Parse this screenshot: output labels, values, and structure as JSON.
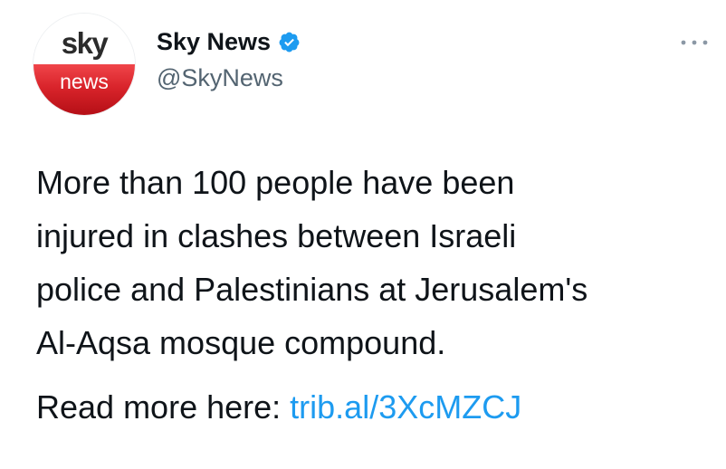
{
  "author": {
    "avatar": {
      "logo_top": "sky",
      "logo_bottom": "news"
    },
    "display_name": "Sky News",
    "verified": true,
    "handle": "@SkyNews"
  },
  "more_menu_icon": "more-horizontal-icon",
  "tweet": {
    "text": "More than 100 people have been\ninjured in clashes between Israeli\npolice and Palestinians at Jerusalem's\nAl-Aqsa mosque compound.",
    "read_more_label": "Read more here: ",
    "link_text": "trib.al/3XcMZCJ"
  },
  "colors": {
    "link": "#1d9bf0",
    "verified_badge": "#1d9bf0",
    "handle": "#536471",
    "text": "#0f1419",
    "logo_red": "#d9242b"
  }
}
